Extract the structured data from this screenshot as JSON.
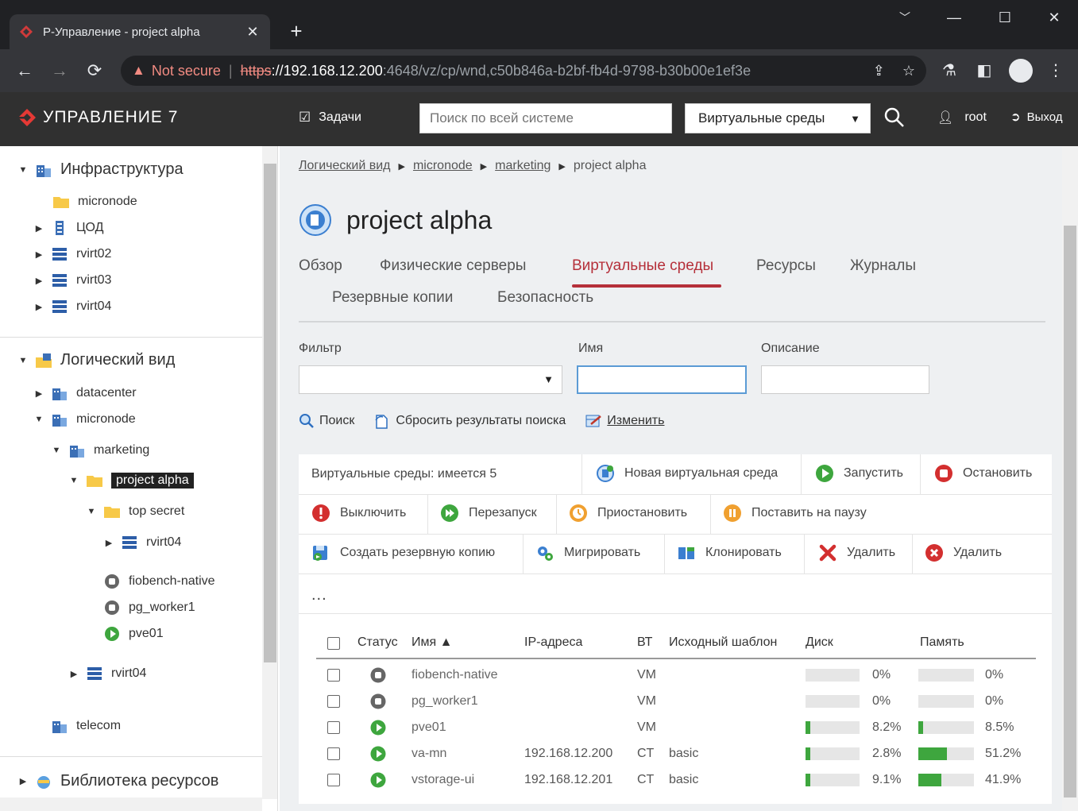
{
  "browser": {
    "tab_title": "Р-Управление - project alpha",
    "tab_close": "✕",
    "new_tab": "+",
    "not_secure": "Not secure",
    "url_scheme": "https",
    "url_host": "://192.168.12.200",
    "url_path": ":4648/vz/cp/wnd,c50b846a-b2bf-fb4d-9798-b30b00e1ef3e"
  },
  "header": {
    "logo": "УПРАВЛЕНИЕ 7",
    "tasks": "Задачи",
    "search_placeholder": "Поиск по всей системе",
    "scope": "Виртуальные среды",
    "user": "root",
    "logout": "Выход"
  },
  "sidebar": {
    "infra": {
      "label": "Инфраструктура",
      "items": [
        "micronode",
        "ЦОД",
        "rvirt02",
        "rvirt03",
        "rvirt04"
      ]
    },
    "logical": {
      "label": "Логический вид",
      "datacenter": "datacenter",
      "micronode": "micronode",
      "marketing": "marketing",
      "project_alpha": "project alpha",
      "top_secret": "top secret",
      "rvirt04_a": "rvirt04",
      "fiobench": "fiobench-native",
      "pg_worker": "pg_worker1",
      "pve01": "pve01",
      "rvirt04_b": "rvirt04",
      "telecom": "telecom"
    },
    "library": "Библиотека ресурсов"
  },
  "breadcrumb": {
    "b1": "Логический вид",
    "b2": "micronode",
    "b3": "marketing",
    "current": "project alpha"
  },
  "page": {
    "title": "project alpha",
    "tabs": {
      "overview": "Обзор",
      "servers": "Физические серверы",
      "ve": "Виртуальные среды",
      "resources": "Ресурсы",
      "logs": "Журналы",
      "backups": "Резервные копии",
      "security": "Безопасность"
    }
  },
  "filters": {
    "filter_label": "Фильтр",
    "name_label": "Имя",
    "desc_label": "Описание",
    "search": "Поиск",
    "reset": "Сбросить результаты поиска",
    "edit": "Изменить"
  },
  "toolbar": {
    "count": "Виртуальные среды: имеется 5",
    "new_ve": "Новая виртуальная среда",
    "start": "Запустить",
    "stop": "Остановить",
    "poweroff": "Выключить",
    "restart": "Перезапуск",
    "suspend": "Приостановить",
    "pause": "Поставить на паузу",
    "backup": "Создать резервную копию",
    "migrate": "Мигрировать",
    "clone": "Клонировать",
    "delete1": "Удалить",
    "delete2": "Удалить",
    "more": "..."
  },
  "grid": {
    "columns": {
      "status": "Статус",
      "name": "Имя ▲",
      "ip": "IP-адреса",
      "vt": "ВТ",
      "template": "Исходный шаблон",
      "disk": "Диск",
      "memory": "Память"
    },
    "rows": [
      {
        "name": "fiobench-native",
        "ip": "",
        "vt": "VM",
        "template": "",
        "disk_label": "0%",
        "disk": 0,
        "mem_label": "0%",
        "mem": 0,
        "running": false
      },
      {
        "name": "pg_worker1",
        "ip": "",
        "vt": "VM",
        "template": "",
        "disk_label": "0%",
        "disk": 0,
        "mem_label": "0%",
        "mem": 0,
        "running": false
      },
      {
        "name": "pve01",
        "ip": "",
        "vt": "VM",
        "template": "",
        "disk_label": "8.2%",
        "disk": 8.2,
        "mem_label": "8.5%",
        "mem": 8.5,
        "running": true
      },
      {
        "name": "va-mn",
        "ip": "192.168.12.200",
        "vt": "CT",
        "template": "basic",
        "disk_label": "2.8%",
        "disk": 2.8,
        "mem_label": "51.2%",
        "mem": 51.2,
        "running": true
      },
      {
        "name": "vstorage-ui",
        "ip": "192.168.12.201",
        "vt": "CT",
        "template": "basic",
        "disk_label": "9.1%",
        "disk": 9.1,
        "mem_label": "41.9%",
        "mem": 41.9,
        "running": true
      }
    ]
  },
  "colors": {
    "accent": "#b5303a",
    "running": "#3ea63e",
    "stopped": "#666666"
  }
}
